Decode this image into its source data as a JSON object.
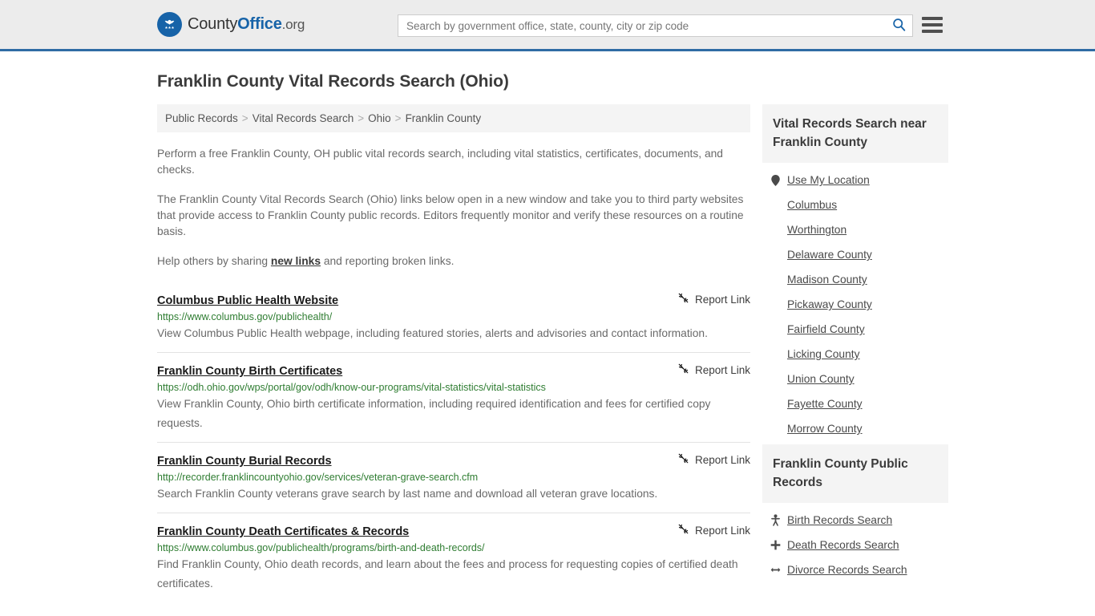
{
  "header": {
    "brand": {
      "part1": "County",
      "part2": "Office",
      "part3": ".org",
      "icon": "eagle-seal-logo"
    },
    "search": {
      "placeholder": "Search by government office, state, county, city or zip code",
      "value": "",
      "search_icon": "search-icon"
    },
    "menu_icon": "hamburger-menu-icon",
    "accent_color": "#2f6ca4"
  },
  "page": {
    "title": "Franklin County Vital Records Search (Ohio)"
  },
  "breadcrumb": {
    "separator": ">",
    "items": [
      {
        "label": "Public Records"
      },
      {
        "label": "Vital Records Search"
      },
      {
        "label": "Ohio"
      },
      {
        "label": "Franklin County"
      }
    ]
  },
  "intro": {
    "p1": "Perform a free Franklin County, OH public vital records search, including vital statistics, certificates, documents, and checks.",
    "p2": "The Franklin County Vital Records Search (Ohio) links below open in a new window and take you to third party websites that provide access to Franklin County public records. Editors frequently monitor and verify these resources on a routine basis.",
    "p3_before": "Help others by sharing ",
    "p3_link": "new links",
    "p3_after": " and reporting broken links."
  },
  "results": {
    "report_label": "Report Link",
    "report_icon": "broken-link-icon",
    "items": [
      {
        "title": "Columbus Public Health Website",
        "url": "https://www.columbus.gov/publichealth/",
        "description": "View Columbus Public Health webpage, including featured stories, alerts and advisories and contact information."
      },
      {
        "title": "Franklin County Birth Certificates",
        "url": "https://odh.ohio.gov/wps/portal/gov/odh/know-our-programs/vital-statistics/vital-statistics",
        "description": "View Franklin County, Ohio birth certificate information, including required identification and fees for certified copy requests."
      },
      {
        "title": "Franklin County Burial Records",
        "url": "http://recorder.franklincountyohio.gov/services/veteran-grave-search.cfm",
        "description": "Search Franklin County veterans grave search by last name and download all veteran grave locations."
      },
      {
        "title": "Franklin County Death Certificates & Records",
        "url": "https://www.columbus.gov/publichealth/programs/birth-and-death-records/",
        "description": "Find Franklin County, Ohio death records, and learn about the fees and process for requesting copies of certified death certificates."
      }
    ]
  },
  "sidebar": {
    "nearby": {
      "heading": "Vital Records Search near Franklin County",
      "items": [
        {
          "label": "Use My Location",
          "icon": "map-pin-icon"
        },
        {
          "label": "Columbus",
          "icon": ""
        },
        {
          "label": "Worthington",
          "icon": ""
        },
        {
          "label": "Delaware County",
          "icon": ""
        },
        {
          "label": "Madison County",
          "icon": ""
        },
        {
          "label": "Pickaway County",
          "icon": ""
        },
        {
          "label": "Fairfield County",
          "icon": ""
        },
        {
          "label": "Licking County",
          "icon": ""
        },
        {
          "label": "Union County",
          "icon": ""
        },
        {
          "label": "Fayette County",
          "icon": ""
        },
        {
          "label": "Morrow County",
          "icon": ""
        }
      ]
    },
    "public_records": {
      "heading": "Franklin County Public Records",
      "items": [
        {
          "label": "Birth Records Search",
          "icon": "baby-icon"
        },
        {
          "label": "Death Records Search",
          "icon": "cross-icon"
        },
        {
          "label": "Divorce Records Search",
          "icon": "split-arrows-icon"
        }
      ]
    }
  }
}
